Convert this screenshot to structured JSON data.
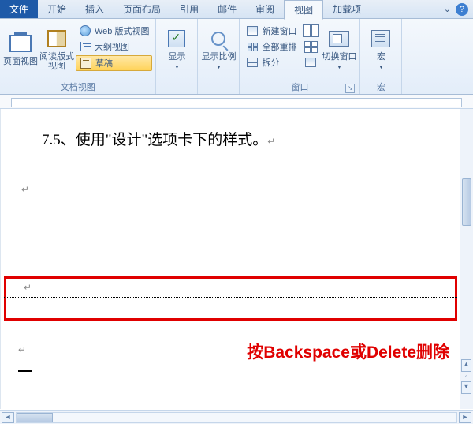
{
  "tabs": {
    "file": "文件",
    "home": "开始",
    "insert": "插入",
    "layout": "页面布局",
    "references": "引用",
    "mail": "邮件",
    "review": "审阅",
    "view": "视图",
    "addins": "加载项"
  },
  "ribbon": {
    "doc_views": {
      "group_label": "文档视图",
      "print_layout": "页面视图",
      "reading": "阅读版式视图",
      "web": "Web 版式视图",
      "outline": "大纲视图",
      "draft": "草稿"
    },
    "show": {
      "group_label": "显示",
      "label": "显示"
    },
    "zoom": {
      "group_label": "显示比例",
      "label": "显示比例"
    },
    "window": {
      "group_label": "窗口",
      "new_window": "新建窗口",
      "arrange_all": "全部重排",
      "split": "拆分",
      "switch": "切换窗口"
    },
    "macros": {
      "group_label": "宏",
      "label": "宏"
    }
  },
  "document": {
    "heading": "7.5、使用\"设计\"选项卡下的样式。",
    "para_mark": "↵",
    "annotation": "按Backspace或Delete删除"
  }
}
